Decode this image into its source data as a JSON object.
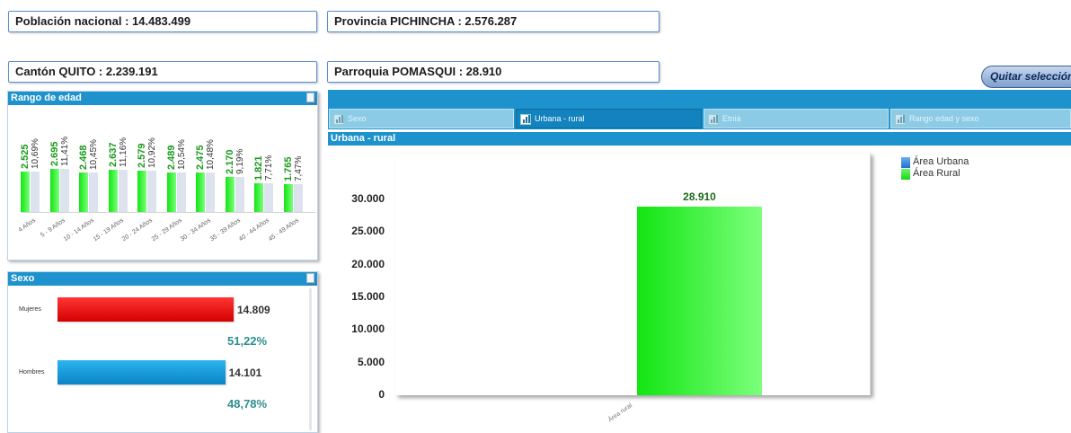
{
  "header": {
    "nacional": "Población nacional :  14.483.499",
    "provincia": "Provincia PICHINCHA : 2.576.287",
    "canton": "Cantón QUITO : 2.239.191",
    "parroquia": "Parroquia POMASQUI : 28.910",
    "quitar_button": "Quitar selección"
  },
  "rango_panel": {
    "title": "Rango de edad",
    "groups": [
      {
        "category": "4 Años",
        "value_label": "2.525",
        "pct_label": "10,69%"
      },
      {
        "category": "5 - 9 Años",
        "value_label": "2.695",
        "pct_label": "11,41%"
      },
      {
        "category": "10 - 14 Años",
        "value_label": "2.468",
        "pct_label": "10,45%"
      },
      {
        "category": "15 - 19 Años",
        "value_label": "2.637",
        "pct_label": "11,16%"
      },
      {
        "category": "20 - 24 Años",
        "value_label": "2.579",
        "pct_label": "10,92%"
      },
      {
        "category": "25 - 29 Años",
        "value_label": "2.489",
        "pct_label": "10,54%"
      },
      {
        "category": "30 - 34 Años",
        "value_label": "2.475",
        "pct_label": "10,48%"
      },
      {
        "category": "35 - 39 Años",
        "value_label": "2.170",
        "pct_label": "9,19%"
      },
      {
        "category": "40 - 44 Años",
        "value_label": "1.821",
        "pct_label": "7,71%"
      },
      {
        "category": "45 - 49 Años",
        "value_label": "1.765",
        "pct_label": "7,47%"
      }
    ]
  },
  "sexo_panel": {
    "title": "Sexo",
    "rows": [
      {
        "label": "Mujeres",
        "value_label": "14.809",
        "pct_label": "51,22%"
      },
      {
        "label": "Hombres",
        "value_label": "14.101",
        "pct_label": "48,78%"
      }
    ]
  },
  "tabs": [
    {
      "label": "Sexo",
      "active": false
    },
    {
      "label": "Urbana - rural",
      "active": true
    },
    {
      "label": "Etnia",
      "active": false
    },
    {
      "label": "Rango edad y sexo",
      "active": false
    }
  ],
  "main_chart": {
    "title": "Urbana - rural",
    "bar_value_label": "28.910",
    "legend": [
      {
        "name": "Área Urbana",
        "color": "#2e7fd8"
      },
      {
        "name": "Área Rural",
        "color": "#2ee82e"
      }
    ],
    "y_tick_labels": [
      "30.000",
      "25.000",
      "20.000",
      "15.000",
      "10.000",
      "5.000",
      "0"
    ]
  },
  "colors": {
    "panel_header": "#1e92cd",
    "bar_green": "#12e512",
    "bar_red": "#e00000",
    "bar_blue": "#1399d8",
    "pct_teal": "#2f8e8e"
  },
  "chart_data": [
    {
      "type": "bar",
      "title": "Rango de edad",
      "categories": [
        "4 Años",
        "5 - 9 Años",
        "10 - 14 Años",
        "15 - 19 Años",
        "20 - 24 Años",
        "25 - 29 Años",
        "30 - 34 Años",
        "35 - 39 Años",
        "40 - 44 Años",
        "45 - 49 Años"
      ],
      "series": [
        {
          "values": [
            2525,
            2695,
            2468,
            2637,
            2579,
            2489,
            2475,
            2170,
            1821,
            1765
          ]
        },
        {
          "values": [
            10.69,
            11.41,
            10.45,
            11.16,
            10.92,
            10.54,
            10.48,
            9.19,
            7.71,
            7.47
          ]
        }
      ]
    },
    {
      "type": "bar",
      "title": "Sexo",
      "categories": [
        "Mujeres",
        "Hombres"
      ],
      "values": [
        14809,
        14101
      ],
      "percentages": [
        51.22,
        48.78
      ]
    },
    {
      "type": "bar",
      "title": "Urbana - rural",
      "categories": [
        "Área rural"
      ],
      "series": [
        {
          "name": "Área Urbana",
          "values": [
            0
          ]
        },
        {
          "name": "Área Rural",
          "values": [
            28910
          ]
        }
      ],
      "ylim": [
        0,
        30000
      ],
      "yticks": [
        0,
        5000,
        10000,
        15000,
        20000,
        25000,
        30000
      ],
      "legend_position": "top-right"
    }
  ]
}
